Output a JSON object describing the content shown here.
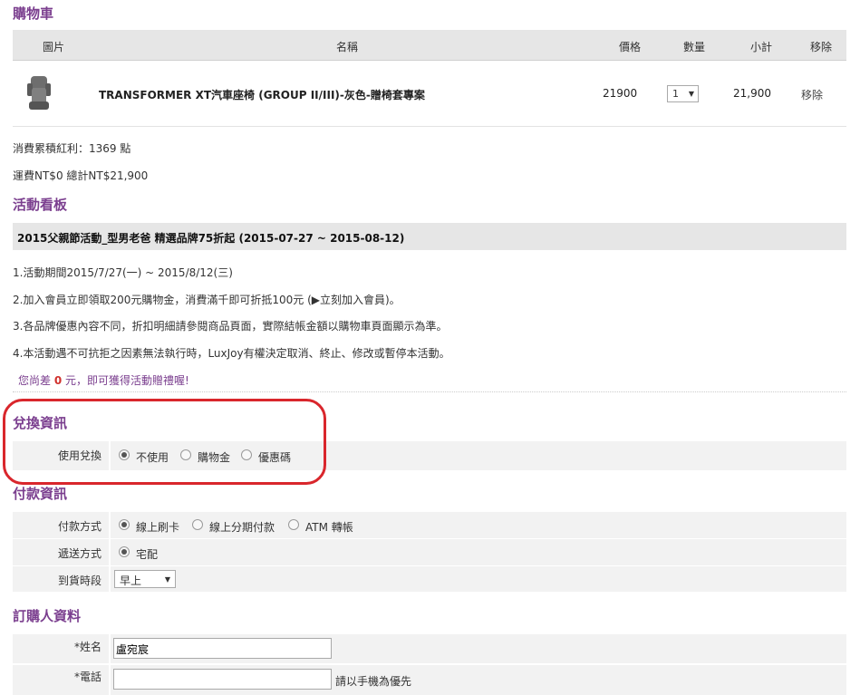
{
  "cart": {
    "title": "購物車",
    "headers": {
      "image": "圖片",
      "name": "名稱",
      "price": "價格",
      "qty": "數量",
      "subtotal": "小計",
      "remove": "移除"
    },
    "item": {
      "name": "TRANSFORMER XT汽車座椅 (GROUP II/III)-灰色-贈椅套專案",
      "price": "21900",
      "qty": "1",
      "subtotal": "21,900",
      "remove": "移除"
    },
    "points": "消費累積紅利：1369 點",
    "totals": "運費NT$0 總計NT$21,900"
  },
  "promo": {
    "title": "活動看板",
    "banner": "2015父親節活動_型男老爸 精選品牌75折起 (2015-07-27 ~ 2015-08-12)",
    "lines": [
      "1.活動期間2015/7/27(一) ~ 2015/8/12(三)",
      "2.加入會員立即領取200元購物金，消費滿千即可折抵100元 (▶立刻加入會員)。",
      "3.各品牌優惠內容不同，折扣明細請參閱商品頁面，實際結帳金額以購物車頁面顯示為準。",
      "4.本活動遇不可抗拒之因素無法執行時，LuxJoy有權決定取消、終止、修改或暫停本活動。"
    ],
    "diff_prefix": "您尚差",
    "diff_amount": "0",
    "diff_suffix": "元，即可獲得活動贈禮喔!"
  },
  "redeem": {
    "title": "兌換資訊",
    "label": "使用兌換",
    "options": [
      "不使用",
      "購物金",
      "優惠碼"
    ],
    "selected": "不使用"
  },
  "payment": {
    "title": "付款資訊",
    "method_label": "付款方式",
    "methods": [
      "線上刷卡",
      "線上分期付款",
      "ATM 轉帳"
    ],
    "method_selected": "線上刷卡",
    "delivery_label": "遞送方式",
    "delivery_option": "宅配",
    "time_label": "到貨時段",
    "time_value": "早上"
  },
  "buyer": {
    "title": "訂購人資料",
    "name_label": "*姓名",
    "name_value": "盧宛宸",
    "phone_label": "*電話",
    "phone_value": "",
    "phone_hint": "請以手機為優先"
  },
  "colors": {
    "accent": "#7b3f8f",
    "highlight": "#d9262c",
    "header_bg": "#e6e6e6"
  }
}
